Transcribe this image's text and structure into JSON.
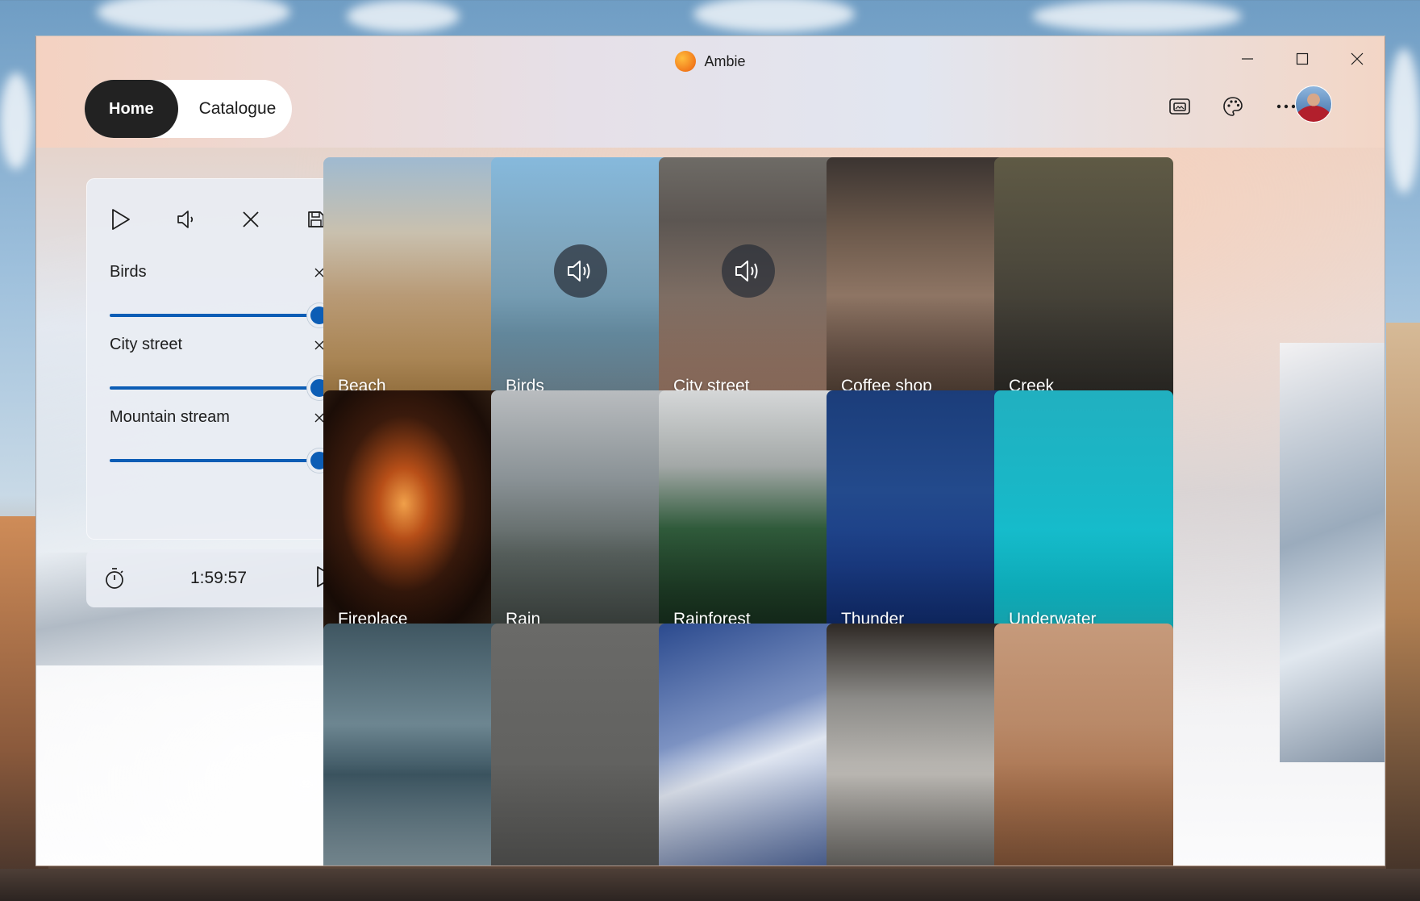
{
  "window": {
    "title": "Ambie"
  },
  "nav": {
    "home": "Home",
    "catalogue": "Catalogue"
  },
  "mixer": {
    "tracks": [
      {
        "name": "Birds",
        "volume_percent": 100
      },
      {
        "name": "City street",
        "volume_percent": 100
      },
      {
        "name": "Mountain stream",
        "volume_percent": 100
      }
    ]
  },
  "timer": {
    "remaining": "1:59:57"
  },
  "sounds": [
    {
      "name": "Beach",
      "playing": false
    },
    {
      "name": "Birds",
      "playing": true
    },
    {
      "name": "City street",
      "playing": true
    },
    {
      "name": "Coffee shop",
      "playing": false
    },
    {
      "name": "Creek",
      "playing": false
    },
    {
      "name": "Fireplace",
      "playing": false
    },
    {
      "name": "Rain",
      "playing": false
    },
    {
      "name": "Rainforest",
      "playing": false
    },
    {
      "name": "Thunder",
      "playing": false
    },
    {
      "name": "Underwater",
      "playing": false
    },
    {
      "name": "",
      "playing": false
    },
    {
      "name": "",
      "playing": false
    },
    {
      "name": "",
      "playing": false
    },
    {
      "name": "",
      "playing": false
    },
    {
      "name": "",
      "playing": false
    }
  ],
  "icons": {
    "app_logo": "ambie-logo-icon",
    "compact_mode": "picture-in-picture-icon",
    "theme": "palette-icon",
    "more": "more-options-icon",
    "play": "play-icon",
    "volume": "volume-icon",
    "clear": "close-icon",
    "save": "save-icon",
    "timer": "stopwatch-icon"
  },
  "colors": {
    "accent": "#0c5db5",
    "nav_active_bg": "#222222"
  }
}
